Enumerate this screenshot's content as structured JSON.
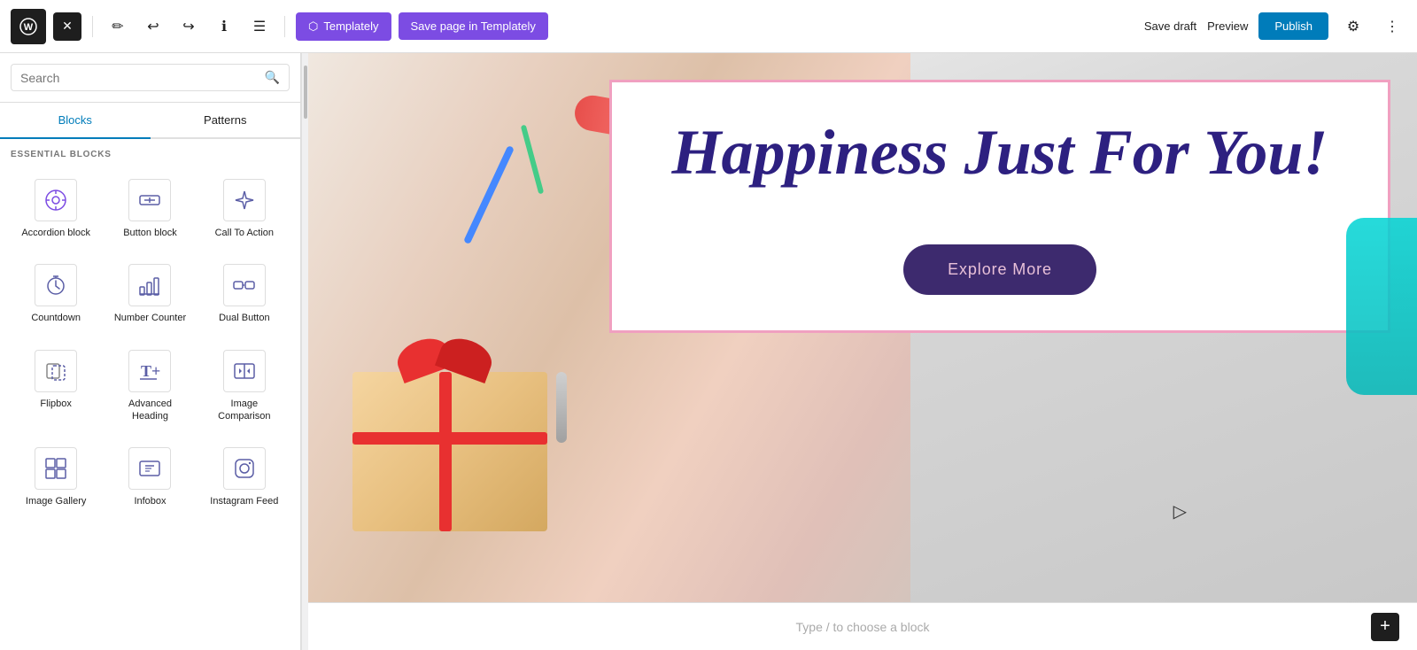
{
  "topbar": {
    "wp_logo": "W",
    "close_label": "✕",
    "undo_label": "↩",
    "redo_label": "↪",
    "info_label": "ℹ",
    "list_label": "☰",
    "templately_label": "Templately",
    "save_templately_label": "Save page in Templately",
    "save_draft_label": "Save draft",
    "preview_label": "Preview",
    "publish_label": "Publish",
    "settings_icon": "⚙",
    "more_icon": "⋮"
  },
  "sidebar": {
    "search_placeholder": "Search",
    "tab_blocks": "Blocks",
    "tab_patterns": "Patterns",
    "section_label": "ESSENTIAL BLOCKS",
    "blocks": [
      {
        "id": "accordion-block",
        "label": "Accordion block",
        "icon": "accordion"
      },
      {
        "id": "button-block",
        "label": "Button block",
        "icon": "button"
      },
      {
        "id": "call-to-action",
        "label": "Call To Action",
        "icon": "cta"
      },
      {
        "id": "countdown",
        "label": "Countdown",
        "icon": "countdown"
      },
      {
        "id": "number-counter",
        "label": "Number Counter",
        "icon": "counter"
      },
      {
        "id": "dual-button",
        "label": "Dual Button",
        "icon": "dual"
      },
      {
        "id": "flipbox",
        "label": "Flipbox",
        "icon": "flipbox"
      },
      {
        "id": "advanced-heading",
        "label": "Advanced Heading",
        "icon": "heading"
      },
      {
        "id": "image-comparison",
        "label": "Image Comparison",
        "icon": "imgcomp"
      },
      {
        "id": "image-gallery",
        "label": "Image Gallery",
        "icon": "gallery"
      },
      {
        "id": "infobox",
        "label": "Infobox",
        "icon": "infobox"
      },
      {
        "id": "instagram-feed",
        "label": "Instagram Feed",
        "icon": "instagram"
      }
    ]
  },
  "canvas": {
    "hero_title": "Happiness Just For You!",
    "explore_btn": "Explore More",
    "type_prompt": "Type / to choose a block",
    "add_block_label": "+"
  }
}
